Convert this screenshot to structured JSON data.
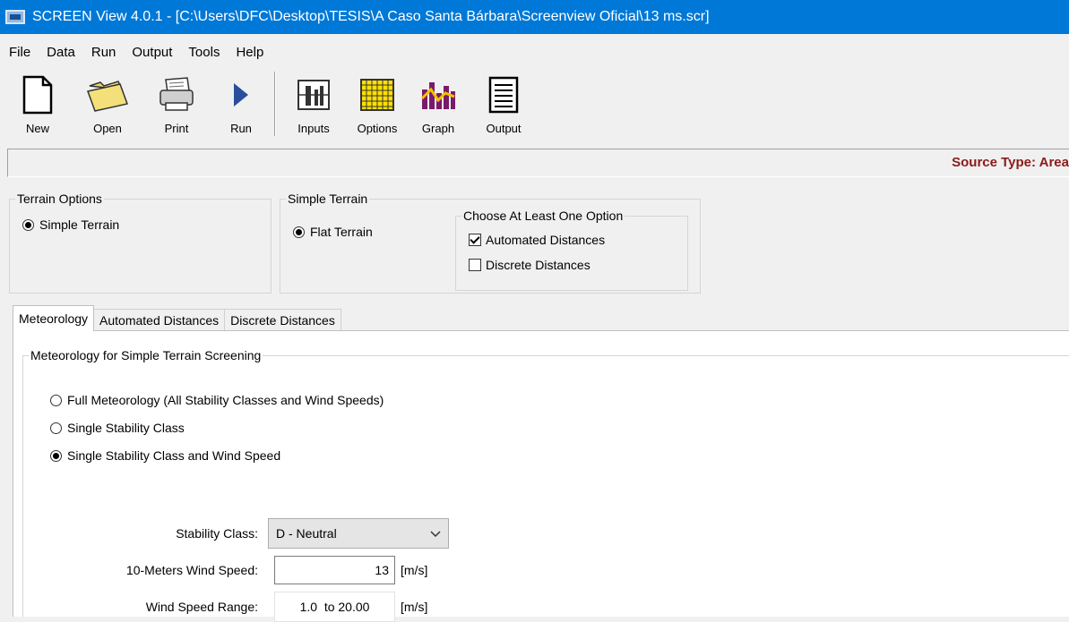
{
  "window": {
    "title": "SCREEN View 4.0.1 - [C:\\Users\\DFC\\Desktop\\TESIS\\A Caso Santa Bárbara\\Screenview Oficial\\13 ms.scr]"
  },
  "menu": [
    "File",
    "Data",
    "Run",
    "Output",
    "Tools",
    "Help"
  ],
  "toolbar": {
    "new": "New",
    "open": "Open",
    "print": "Print",
    "run": "Run",
    "inputs": "Inputs",
    "options": "Options",
    "graph": "Graph",
    "output": "Output"
  },
  "status": {
    "source_type": "Source Type: Area"
  },
  "terrain_options": {
    "title": "Terrain Options",
    "simple_terrain": "Simple Terrain",
    "simple_terrain_selected": true
  },
  "simple_terrain": {
    "title": "Simple Terrain",
    "flat_terrain": "Flat Terrain",
    "flat_terrain_selected": true,
    "choose": {
      "title": "Choose At Least One Option",
      "automated": "Automated Distances",
      "automated_checked": true,
      "discrete": "Discrete Distances",
      "discrete_checked": false
    }
  },
  "tabs": [
    {
      "label": "Meteorology",
      "active": true
    },
    {
      "label": "Automated Distances",
      "active": false
    },
    {
      "label": "Discrete Distances",
      "active": false
    }
  ],
  "meteorology": {
    "group_title": "Meteorology for Simple Terrain Screening",
    "options": [
      {
        "label": "Full Meteorology (All Stability Classes and Wind Speeds)",
        "selected": false
      },
      {
        "label": "Single Stability Class",
        "selected": false
      },
      {
        "label": "Single Stability Class and Wind Speed",
        "selected": true
      }
    ],
    "stability_class_label": "Stability Class:",
    "stability_class_value": "D - Neutral",
    "wind_speed_label": "10-Meters Wind Speed:",
    "wind_speed_value": "13",
    "wind_speed_unit": "[m/s]",
    "range_label": "Wind Speed Range:",
    "range_value": "1.0  to 20.00",
    "range_unit": "[m/s]"
  }
}
